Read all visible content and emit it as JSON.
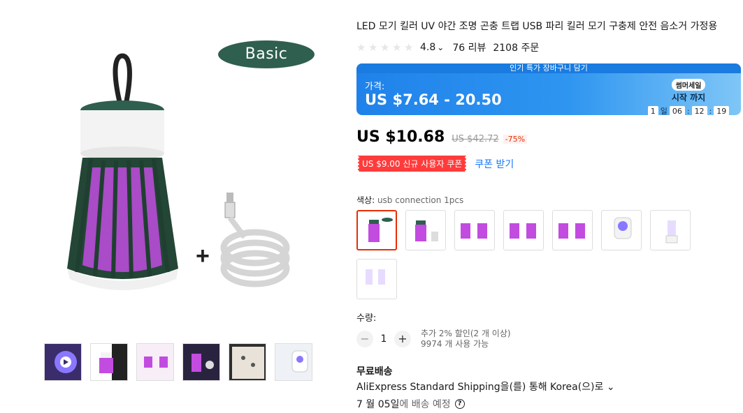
{
  "gallery": {
    "badge": "Basic",
    "plus_sign": "+"
  },
  "product": {
    "title": "LED 모기 킬러 UV 야간 조명 곤충 트랩 USB 파리 킬러 모기 구충제 안전 음소거 가정용",
    "rating": "4.8",
    "rating_caret": "⌄",
    "reviews": "76 리뷰",
    "orders": "2108 주문"
  },
  "promo": {
    "banner": "인기 특가 장바구니 담기",
    "price_label": "가격:",
    "price_range": "US $7.64 - 20.50",
    "sale_name": "썸머세일",
    "start_text": "시작 까지",
    "days": "1",
    "day_unit": "일",
    "hours": "06",
    "minutes": "12",
    "seconds": "19",
    "colon": ":"
  },
  "price": {
    "current": "US $10.68",
    "original": "US $42.72",
    "discount": "-75%"
  },
  "coupon": {
    "label": "US $9.00 신규 사용자 쿠폰",
    "get": "쿠폰 받기"
  },
  "color": {
    "label": "색상:",
    "selected": "usb connection 1pcs",
    "options_count_visible": 8
  },
  "quantity": {
    "label": "수량:",
    "minus": "−",
    "plus": "+",
    "value": "1",
    "extra_discount": "추가 2% 할인(2 개 이상)",
    "available": "9974 개 사용 가능"
  },
  "shipping": {
    "title": "무료배송",
    "method": "AliExpress Standard Shipping을(를) 통해 Korea(으)로 ⌄",
    "date": "7 월 05일",
    "date_suffix": "에 배송 예정",
    "help": "?"
  },
  "colors": {
    "accent_red": "#e62e04",
    "link_blue": "#1677ff",
    "promo_blue": "#1f82ea",
    "badge_green": "#2f5f4e"
  }
}
